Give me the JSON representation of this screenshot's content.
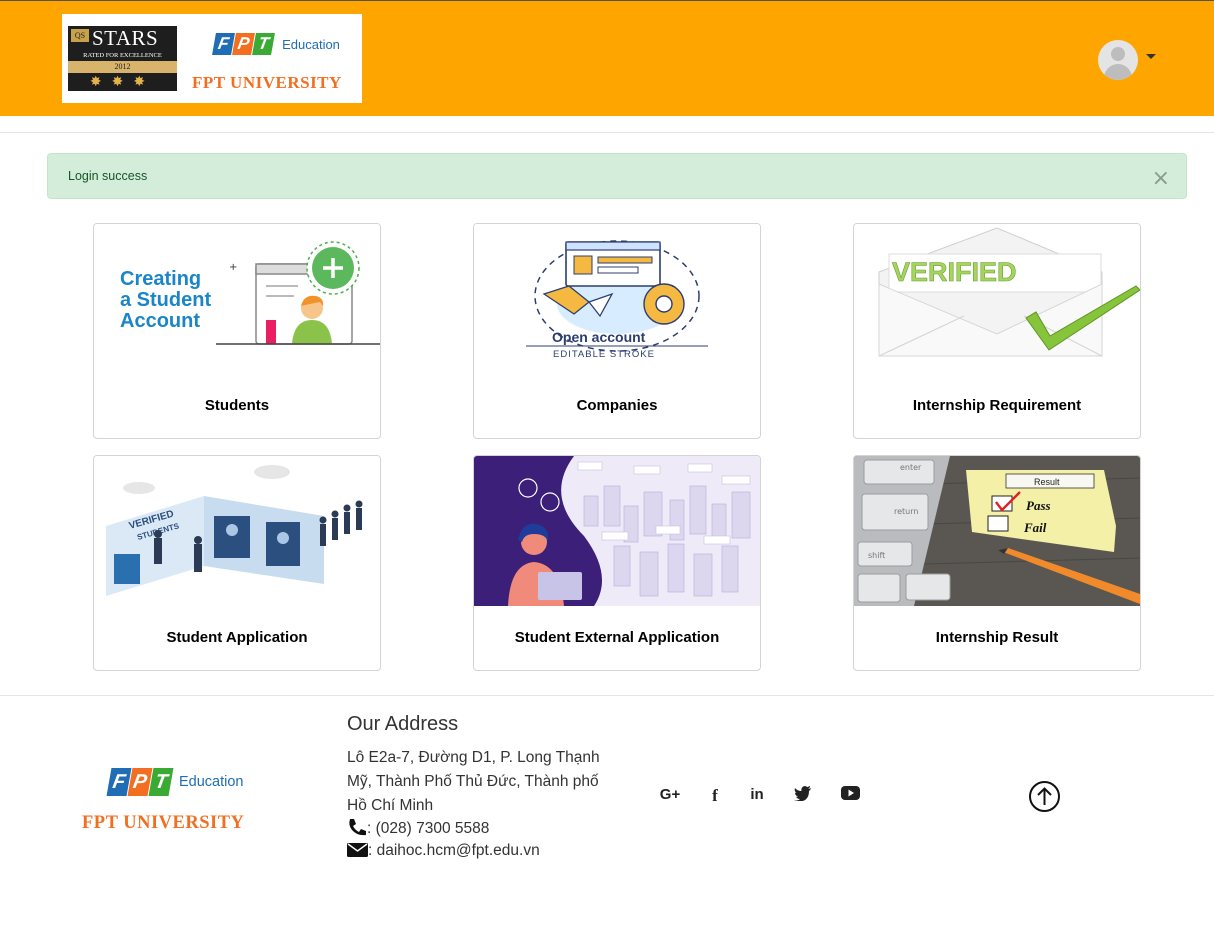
{
  "header": {
    "background": "#ffa500",
    "qs_badge": "QS",
    "stars_word": "STARS",
    "stars_rated": "RATED FOR EXCELLENCE",
    "stars_year": "2012",
    "fpt_letters": [
      "F",
      "P",
      "T"
    ],
    "education_label": "Education",
    "university_label": "FPT UNIVERSITY"
  },
  "alert": {
    "message": "Login success",
    "close_glyph": "×",
    "background": "#d4edda"
  },
  "cards": [
    {
      "title": "Students",
      "image_text": [
        "Creating",
        "a Student",
        "Account"
      ]
    },
    {
      "title": "Companies",
      "image_text": [
        "Open account",
        "EDITABLE STROKE"
      ]
    },
    {
      "title": "Internship Requirement",
      "image_text": [
        "VERIFIED"
      ]
    },
    {
      "title": "Student Application",
      "image_text": [
        "VERIFIED",
        "STUDENTS"
      ]
    },
    {
      "title": "Student External Application",
      "image_text": []
    },
    {
      "title": "Internship Result",
      "image_text": [
        "Result",
        "Pass",
        "Fail",
        "enter",
        "return",
        "shift"
      ]
    }
  ],
  "footer": {
    "fpt_letters": [
      "F",
      "P",
      "T"
    ],
    "education_label": "Education",
    "university_label": "FPT UNIVERSITY",
    "address_title": "Our Address",
    "address": "Lô E2a-7, Đường D1, P. Long Thạnh Mỹ, Thành Phố Thủ Đức, Thành phố Hồ Chí Minh",
    "phone": ": (028) 7300 5588",
    "email": ": daihoc.hcm@fpt.edu.vn",
    "social": [
      {
        "name": "google-plus-icon",
        "glyph": "G+"
      },
      {
        "name": "facebook-icon",
        "glyph": "f"
      },
      {
        "name": "linkedin-icon",
        "glyph": "in"
      },
      {
        "name": "twitter-icon",
        "glyph": "twitter"
      },
      {
        "name": "youtube-icon",
        "glyph": "youtube"
      }
    ]
  }
}
